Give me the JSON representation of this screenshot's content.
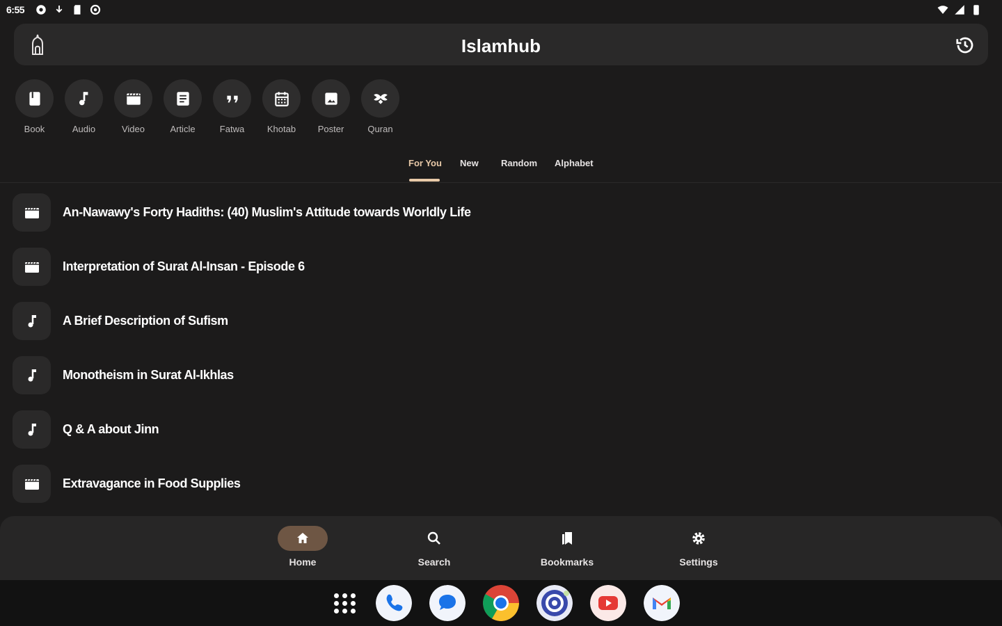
{
  "status": {
    "time": "6:55",
    "left_icons": [
      "settings-icon",
      "download-icon",
      "sd-card-icon",
      "record-icon"
    ],
    "right_icons": [
      "wifi-icon",
      "signal-icon",
      "battery-icon"
    ]
  },
  "header": {
    "title": "Islamhub",
    "logo_icon": "mosque-logo-icon",
    "history_icon": "history-icon"
  },
  "categories": [
    {
      "label": "Book",
      "icon": "book-icon"
    },
    {
      "label": "Audio",
      "icon": "music-note-icon"
    },
    {
      "label": "Video",
      "icon": "video-icon"
    },
    {
      "label": "Article",
      "icon": "article-icon"
    },
    {
      "label": "Fatwa",
      "icon": "quote-icon"
    },
    {
      "label": "Khotab",
      "icon": "calendar-icon"
    },
    {
      "label": "Poster",
      "icon": "image-icon"
    },
    {
      "label": "Quran",
      "icon": "quran-icon"
    }
  ],
  "tabs": [
    {
      "label": "For You",
      "active": true
    },
    {
      "label": "New",
      "active": false
    },
    {
      "label": "Random",
      "active": false
    },
    {
      "label": "Alphabet",
      "active": false
    }
  ],
  "items": [
    {
      "title": "An-Nawawy's Forty Hadiths: (40) Muslim's Attitude towards Worldly Life",
      "type": "video"
    },
    {
      "title": "Interpretation of Surat Al-Insan - Episode 6",
      "type": "video"
    },
    {
      "title": "A Brief Description of Sufism",
      "type": "audio"
    },
    {
      "title": "Monotheism in Surat Al-Ikhlas",
      "type": "audio"
    },
    {
      "title": "Q & A about Jinn",
      "type": "audio"
    },
    {
      "title": "Extravagance in Food Supplies",
      "type": "video"
    }
  ],
  "bottom_nav": [
    {
      "label": "Home",
      "icon": "home-icon",
      "active": true
    },
    {
      "label": "Search",
      "icon": "search-icon",
      "active": false
    },
    {
      "label": "Bookmarks",
      "icon": "bookmarks-icon",
      "active": false
    },
    {
      "label": "Settings",
      "icon": "settings-icon",
      "active": false
    }
  ],
  "dock": [
    "app-drawer-icon",
    "phone-app-icon",
    "messages-app-icon",
    "chrome-app-icon",
    "camera-app-icon",
    "youtube-app-icon",
    "gmail-app-icon"
  ],
  "colors": {
    "background": "#1c1b1b",
    "surface": "#2a2929",
    "accent": "#e8c9a8",
    "nav_active": "#6e5644"
  }
}
